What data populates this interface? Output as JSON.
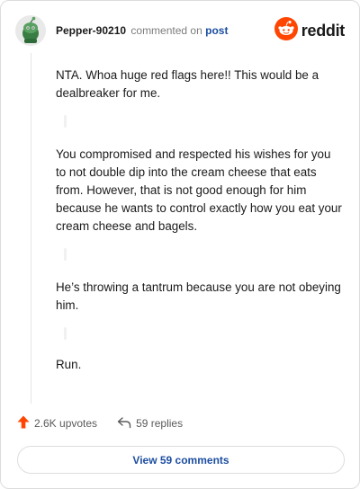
{
  "header": {
    "username": "Pepper-90210",
    "commented_text": "commented on",
    "post_link": "post",
    "logo_text": "reddit"
  },
  "comment": {
    "paragraphs": [
      "NTA. Whoa huge red flags here!! This would be a dealbreaker for me.",
      "You compromised and respected his wishes for you to not double dip into the cream cheese that eats from. However, that is not good enough for him because he wants to control exactly how you eat your cream cheese and bagels.",
      "He’s throwing a tantrum because you are not obeying him.",
      "Run."
    ]
  },
  "actions": {
    "upvotes": "2.6K upvotes",
    "replies": "59 replies"
  },
  "view_comments_label": "View 59 comments",
  "colors": {
    "upvote": "#ff4500",
    "link": "#1d4ea0",
    "reddit_orange": "#ff4500"
  },
  "icons": {
    "avatar": "snoo-avatar-icon",
    "logo": "reddit-logo-icon",
    "upvote": "upvote-arrow-icon",
    "reply": "reply-arrow-icon"
  }
}
